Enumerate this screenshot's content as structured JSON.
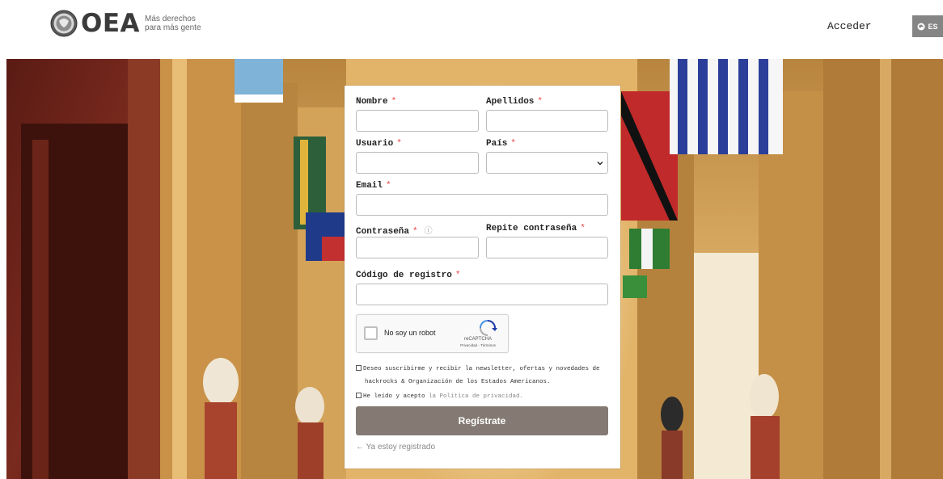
{
  "header": {
    "logo_text": "OEA",
    "tagline_line1": "Más derechos",
    "tagline_line2": "para más gente",
    "login_label": "Acceder",
    "lang_label": "ES"
  },
  "form": {
    "fields": {
      "nombre": {
        "label": "Nombre",
        "required_mark": "*",
        "value": ""
      },
      "apellidos": {
        "label": "Apellidos",
        "required_mark": "*",
        "value": ""
      },
      "usuario": {
        "label": "Usuario",
        "required_mark": "*",
        "value": ""
      },
      "pais": {
        "label": "País",
        "required_mark": "*",
        "selected": ""
      },
      "email": {
        "label": "Email",
        "required_mark": "*",
        "value": ""
      },
      "password": {
        "label": "Contraseña",
        "required_mark": "*",
        "help_icon": "help-circle-icon",
        "value": ""
      },
      "password_repeat": {
        "label": "Repite contraseña",
        "required_mark": "*",
        "value": ""
      },
      "registration_code": {
        "label": "Código de registro",
        "required_mark": "*",
        "value": ""
      }
    },
    "recaptcha": {
      "label": "No soy un robot",
      "brand": "reCAPTCHA",
      "terms": "Privacidad - Términos"
    },
    "newsletter_line1": "Deseo suscribirme y recibir la newsletter, ofertas y novedades de",
    "newsletter_line2": "hackrocks & Organización de los Estados Americanos.",
    "privacy_prefix": "He leído y acepto ",
    "privacy_link": "la Política de privacidad.",
    "submit_label": "Regístrate",
    "already_registered": "← Ya estoy registrado"
  },
  "colors": {
    "submit_bg": "#847a73",
    "required": "#ee4444",
    "lang_bg": "#858585"
  }
}
